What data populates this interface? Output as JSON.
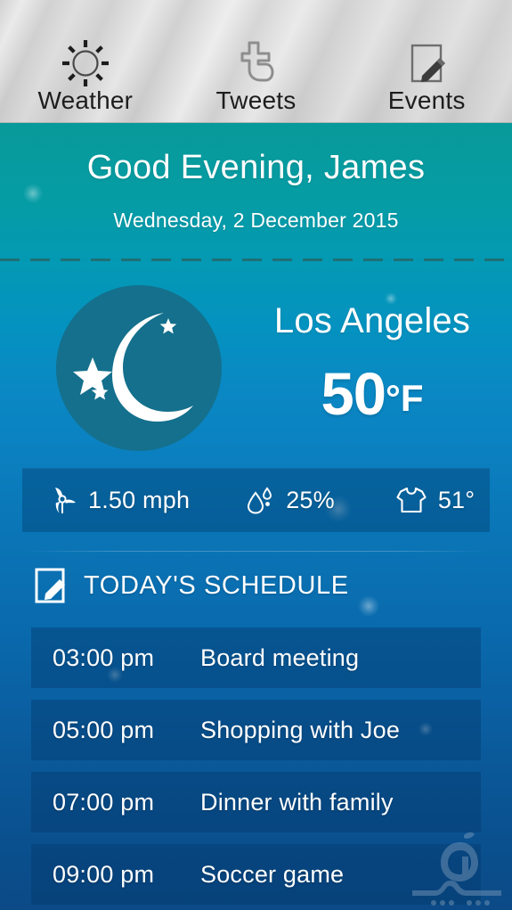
{
  "navbar": {
    "items": [
      {
        "label": "Weather",
        "icon": "sun-icon",
        "name": "nav-item-weather"
      },
      {
        "label": "Tweets",
        "icon": "twitter-icon",
        "name": "nav-item-tweets"
      },
      {
        "label": "Events",
        "icon": "note-pencil-icon",
        "name": "nav-item-events"
      }
    ]
  },
  "greeting": {
    "title": "Good Evening, James",
    "date": "Wednesday, 2 December 2015"
  },
  "current_weather": {
    "condition_icon": "crescent-moon-stars-icon",
    "city": "Los Angeles",
    "temperature": "50",
    "unit": "°F"
  },
  "stats": [
    {
      "icon": "wind-turbine-icon",
      "value": "1.50 mph",
      "name": "stat-wind"
    },
    {
      "icon": "water-drop-icon",
      "value": "25%",
      "name": "stat-humidity"
    },
    {
      "icon": "tshirt-icon",
      "value": "51°",
      "name": "stat-clothing"
    }
  ],
  "schedule": {
    "header_icon": "note-pencil-icon",
    "header_label": "TODAY'S SCHEDULE",
    "rows": [
      {
        "time": "03:00 pm",
        "title": "Board meeting"
      },
      {
        "time": "05:00 pm",
        "title": "Shopping with Joe"
      },
      {
        "time": "07:00 pm",
        "title": "Dinner with family"
      },
      {
        "time": "09:00 pm",
        "title": "Soccer game"
      }
    ]
  },
  "watermark": {
    "icon": "sibche-watermark-logo"
  },
  "colors": {
    "navbar_metal": "#cfcfcf",
    "teal_top": "#089a99",
    "blue_bottom": "#0b4a86",
    "moon_badge": "#14708c",
    "panel_overlay": "rgba(2,62,112,0.42)",
    "text_primary": "#ffffff",
    "nav_label": "#1d1d1d",
    "divider_dash": "#1f6f75"
  }
}
